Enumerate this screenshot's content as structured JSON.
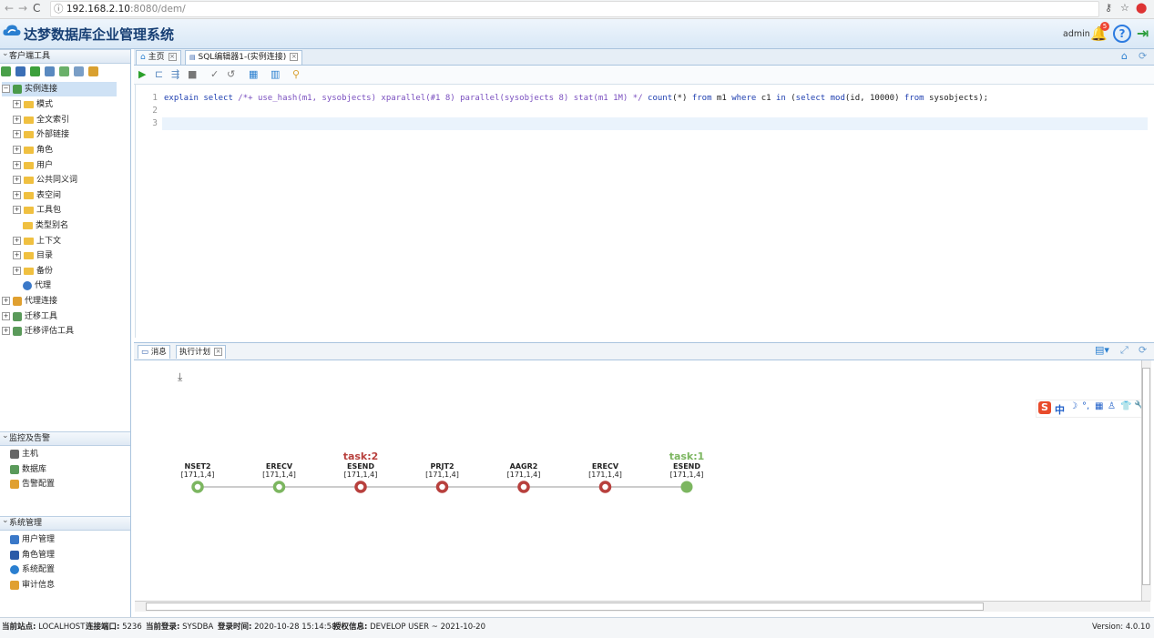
{
  "browser": {
    "url_host": "192.168.2.10",
    "url_path": ":8080/dem/"
  },
  "header": {
    "title": "达梦数据库企业管理系统",
    "user": "admin",
    "notification_count": "5"
  },
  "sidebar": {
    "client_tools_label": "客户端工具",
    "tree_root": "实例连接",
    "tree_items": [
      "模式",
      "全文索引",
      "外部链接",
      "角色",
      "用户",
      "公共同义词",
      "表空间",
      "工具包",
      "类型别名",
      "上下文",
      "目录",
      "备份",
      "代理"
    ],
    "top_items": [
      "代理连接",
      "迁移工具",
      "迁移评估工具"
    ],
    "monitor_label": "监控及告警",
    "monitor_items": [
      "主机",
      "数据库",
      "告警配置"
    ],
    "system_label": "系统管理",
    "system_items": [
      "用户管理",
      "角色管理",
      "系统配置",
      "审计信息"
    ]
  },
  "tabs": {
    "home": "主页",
    "sql_editor": "SQL编辑器1-(实例连接)"
  },
  "editor": {
    "line_numbers": [
      "1",
      "2",
      "3"
    ],
    "sql": "explain select /*+ use_hash(m1, sysobjects) xparallel(#1 8) parallel(sysobjects 8) stat(m1 1M) */ count(*) from m1 where c1 in (select mod(id, 10000) from sysobjects);"
  },
  "bottom_tabs": {
    "messages": "消息",
    "plan": "执行计划"
  },
  "plan": {
    "nodes": [
      {
        "name": "NSET2",
        "coord": "[171,1,4]",
        "status": "ok"
      },
      {
        "name": "ERECV",
        "coord": "[171,1,4]",
        "status": "ok"
      },
      {
        "name": "ESEND",
        "coord": "[171,1,4]",
        "status": "task",
        "task": "task:2"
      },
      {
        "name": "PRJT2",
        "coord": "[171,1,4]",
        "status": "task"
      },
      {
        "name": "AAGR2",
        "coord": "[171,1,4]",
        "status": "task"
      },
      {
        "name": "ERECV",
        "coord": "[171,1,4]",
        "status": "task"
      },
      {
        "name": "ESEND",
        "coord": "[171,1,4]",
        "status": "ok-filled",
        "task": "task:1"
      }
    ]
  },
  "ime": {
    "label": "中"
  },
  "status": {
    "site_label": "当前站点:",
    "site": "LOCALHOST",
    "port_label": "连接端口:",
    "port": "5236",
    "login_label": "当前登录:",
    "login": "SYSDBA",
    "time_label": "登录时间:",
    "time": "2020-10-28 15:14:58",
    "license_label": "授权信息:",
    "license": "DEVELOP USER ~ 2021-10-20",
    "version": "Version: 4.0.10"
  },
  "colors": {
    "ok_green": "#7cb660",
    "task_red": "#b8403d",
    "keyword_blue": "#1f3fb0"
  }
}
